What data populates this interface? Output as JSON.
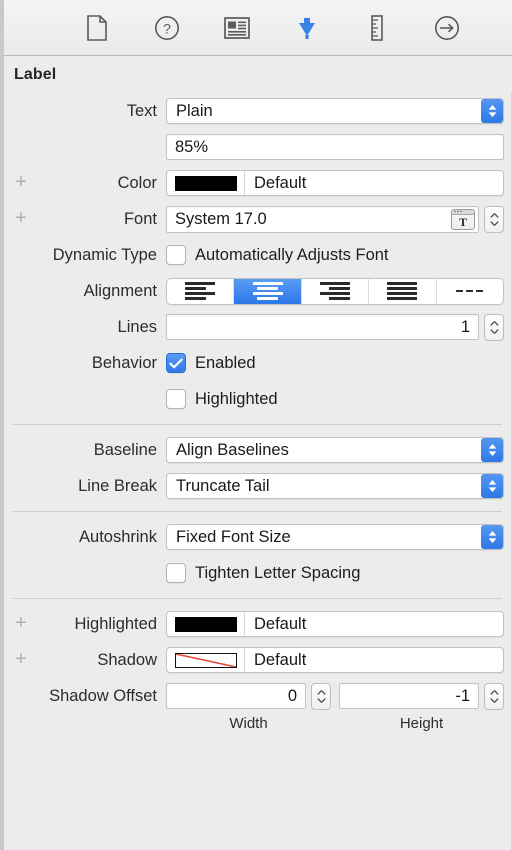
{
  "toolbar": {
    "items": [
      {
        "name": "file-inspector",
        "icon": "document-icon",
        "selected": false
      },
      {
        "name": "quick-help-inspector",
        "icon": "question-circle-icon",
        "selected": false
      },
      {
        "name": "identity-inspector",
        "icon": "identity-card-icon",
        "selected": false
      },
      {
        "name": "attributes-inspector",
        "icon": "attributes-arrow-icon",
        "selected": true
      },
      {
        "name": "size-inspector",
        "icon": "ruler-icon",
        "selected": false
      },
      {
        "name": "connections-inspector",
        "icon": "arrow-right-circle-icon",
        "selected": false
      }
    ],
    "accent": "#3b82e8"
  },
  "section": {
    "title": "Label"
  },
  "fields": {
    "text": {
      "label": "Text",
      "value": "Plain"
    },
    "text_content": {
      "value": "85%",
      "placeholder": ""
    },
    "color": {
      "label": "Color",
      "swatch": "#000000",
      "value": "Default"
    },
    "font": {
      "label": "Font",
      "value": "System 17.0",
      "button": "T"
    },
    "dynamic_type": {
      "label": "Dynamic Type",
      "checkbox_label": "Automatically Adjusts Font",
      "checked": false
    },
    "alignment": {
      "label": "Alignment",
      "options": [
        "align-left",
        "align-center",
        "align-right",
        "align-justified",
        "align-natural"
      ],
      "selected_index": 1
    },
    "lines": {
      "label": "Lines",
      "value": "1"
    },
    "behavior": {
      "label": "Behavior",
      "options": [
        {
          "label": "Enabled",
          "checked": true
        },
        {
          "label": "Highlighted",
          "checked": false
        }
      ]
    },
    "baseline": {
      "label": "Baseline",
      "value": "Align Baselines"
    },
    "line_break": {
      "label": "Line Break",
      "value": "Truncate Tail"
    },
    "autoshrink": {
      "label": "Autoshrink",
      "value": "Fixed Font Size"
    },
    "tighten": {
      "checkbox_label": "Tighten Letter Spacing",
      "checked": false
    },
    "highlighted_color": {
      "label": "Highlighted",
      "swatch": "#000000",
      "value": "Default"
    },
    "shadow_color": {
      "label": "Shadow",
      "swatch": "clear",
      "value": "Default"
    },
    "shadow_offset": {
      "label": "Shadow Offset",
      "width": {
        "value": "0",
        "sublabel": "Width"
      },
      "height": {
        "value": "-1",
        "sublabel": "Height"
      }
    }
  }
}
